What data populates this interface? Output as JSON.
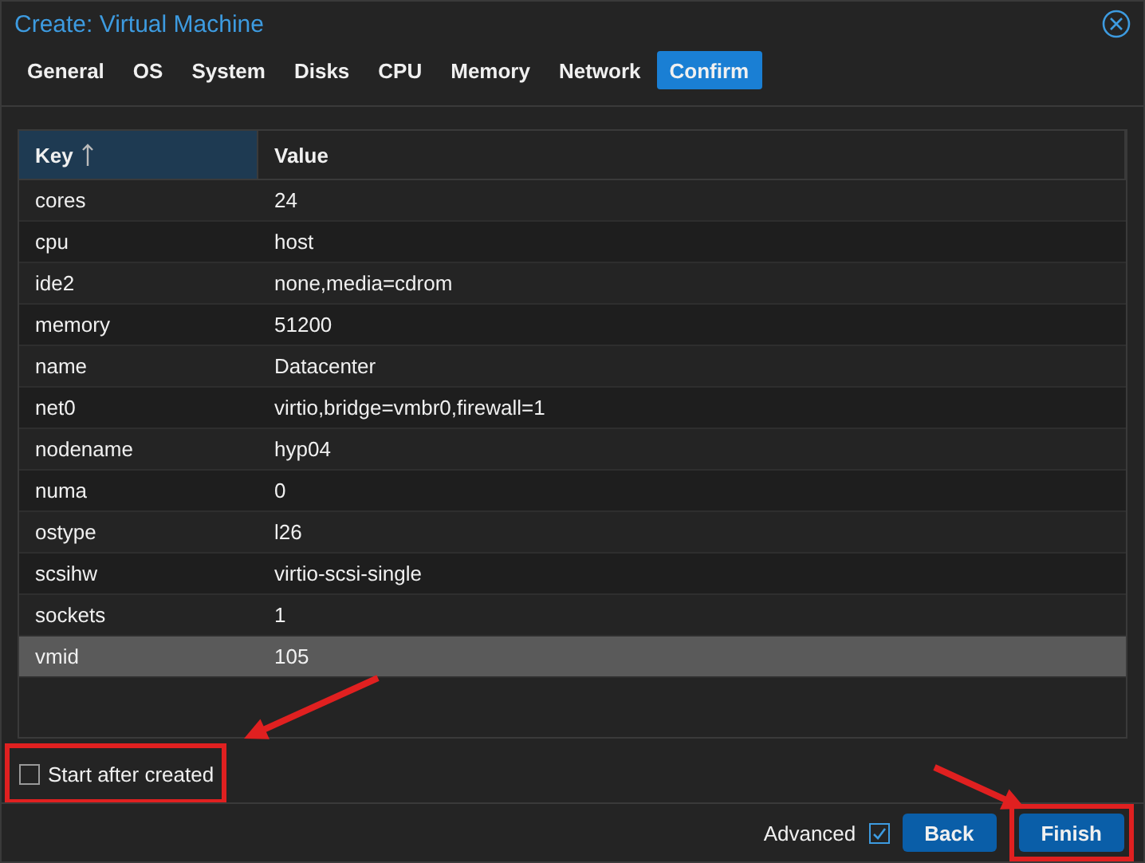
{
  "window": {
    "title": "Create: Virtual Machine"
  },
  "tabs": [
    {
      "label": "General",
      "selected": false
    },
    {
      "label": "OS",
      "selected": false
    },
    {
      "label": "System",
      "selected": false
    },
    {
      "label": "Disks",
      "selected": false
    },
    {
      "label": "CPU",
      "selected": false
    },
    {
      "label": "Memory",
      "selected": false
    },
    {
      "label": "Network",
      "selected": false
    },
    {
      "label": "Confirm",
      "selected": true
    }
  ],
  "table": {
    "columns": [
      {
        "label": "Key",
        "sorted": true
      },
      {
        "label": "Value",
        "sorted": false
      }
    ],
    "rows": [
      {
        "key": "cores",
        "value": "24",
        "selected": false
      },
      {
        "key": "cpu",
        "value": "host",
        "selected": false
      },
      {
        "key": "ide2",
        "value": "none,media=cdrom",
        "selected": false
      },
      {
        "key": "memory",
        "value": "51200",
        "selected": false
      },
      {
        "key": "name",
        "value": "Datacenter",
        "selected": false
      },
      {
        "key": "net0",
        "value": "virtio,bridge=vmbr0,firewall=1",
        "selected": false
      },
      {
        "key": "nodename",
        "value": "hyp04",
        "selected": false
      },
      {
        "key": "numa",
        "value": "0",
        "selected": false
      },
      {
        "key": "ostype",
        "value": "l26",
        "selected": false
      },
      {
        "key": "scsihw",
        "value": "virtio-scsi-single",
        "selected": false
      },
      {
        "key": "sockets",
        "value": "1",
        "selected": false
      },
      {
        "key": "vmid",
        "value": "105",
        "selected": true
      }
    ]
  },
  "start_after_created": {
    "label": "Start after created",
    "checked": false,
    "highlighted": true
  },
  "footer": {
    "advanced": {
      "label": "Advanced",
      "checked": true
    },
    "buttons": [
      {
        "label": "Back",
        "highlighted": false
      },
      {
        "label": "Finish",
        "highlighted": true
      }
    ]
  }
}
